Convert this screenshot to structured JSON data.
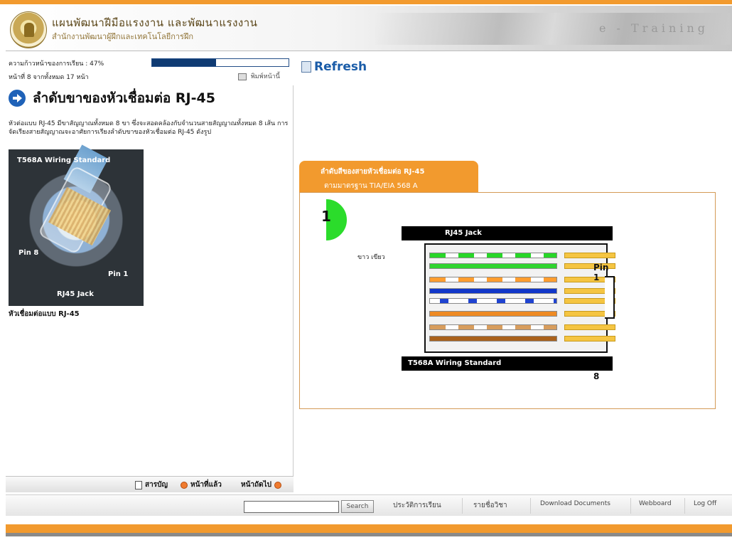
{
  "header": {
    "title_thai": "แผนพัฒนาฝีมือแรงงาน และพัฒนาแรงงาน",
    "subtitle_thai": "สำนักงานพัฒนาผู้ฝึกและเทคโนโลยีการฝึก",
    "banner_text": "e - Training"
  },
  "lesson": {
    "progress_label": "ความก้าวหน้าของการเรียน : 47%",
    "progress_value": 47,
    "page_label": "หน้าที่ 8 จากทั้งหมด 17 หน้า",
    "print_label": "พิมพ์หน้านี้",
    "title": "ลำดับขาของหัวเชื่อมต่อ RJ-45",
    "description": "หัวต่อแบบ RJ-45 มีขาสัญญาณทั้งหมด 8 ขา ซึ่งจะสอดคล้องกับจำนวนสายสัญญาณทั้งหมด 8 เส้น การจัดเรียงสายสัญญาณจะอาศัยการเรียงลำดับขาของหัวเชื่อมต่อ RJ-45 ดังรูป",
    "image_labels": {
      "top": "T568A Wiring Standard",
      "pin8": "Pin 8",
      "pin1": "Pin 1",
      "bottom": "RJ45 Jack"
    },
    "caption": "หัวเชื่อมต่อแบบ RJ-45"
  },
  "navigation": {
    "contents": "สารบัญ",
    "previous": "หน้าที่แล้ว",
    "next": "หน้าถัดไป"
  },
  "right_panel": {
    "refresh": "Refresh",
    "tab_line1": "ลำดับสีของสายหัวเชื่อมต่อ RJ-45",
    "tab_line2": "ตามมาตรฐาน TIA/EIA 568 A",
    "step_number": "1",
    "diagram": {
      "top_label": "RJ45 Jack",
      "pin1": "Pin 1",
      "pin8": "Pin 8",
      "bottom_label": "T568A Wiring Standard",
      "side_label": "ขาว เขียว"
    }
  },
  "footer_bar": {
    "search_placeholder": "",
    "search_button": "Search",
    "menu_1": "ประวัติการเรียน",
    "menu_2": "รายชื่อวิชา",
    "menu_3": "Download Documents",
    "menu_4": "Webboard",
    "menu_5": "Log Off"
  },
  "colors": {
    "accent": "#f29a2e",
    "progress": "#0f3b73",
    "link": "#1a5ca8"
  }
}
